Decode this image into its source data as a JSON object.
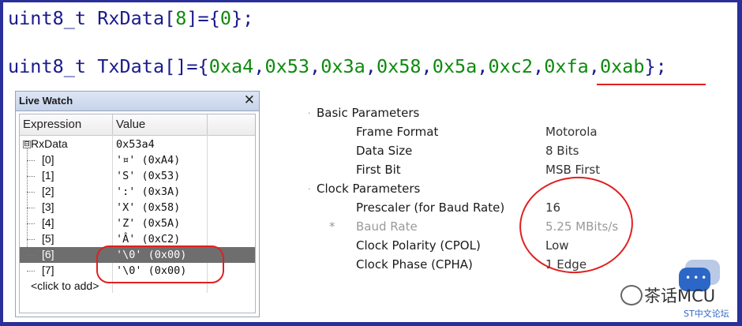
{
  "code": {
    "line1": {
      "type": "uint8_t",
      "name": "RxData",
      "open": "[",
      "size": "8",
      "close": "]={",
      "init": "0",
      "end": "};"
    },
    "line2": {
      "type": "uint8_t",
      "name": "TxData",
      "brackets": "[]={",
      "values": [
        "0xa4",
        "0x53",
        "0x3a",
        "0x58",
        "0x5a",
        "0xc2",
        "0xfa",
        "0xab"
      ],
      "end": "};"
    }
  },
  "watch": {
    "title": "Live Watch",
    "close_icon": "close-icon",
    "columns": {
      "expression": "Expression",
      "value": "Value"
    },
    "root": {
      "expander": "⊟",
      "name": "RxData",
      "value": "0x53a4"
    },
    "rows": [
      {
        "name": "[0]",
        "value": "'¤' (0xA4)"
      },
      {
        "name": "[1]",
        "value": "'S' (0x53)"
      },
      {
        "name": "[2]",
        "value": "':' (0x3A)"
      },
      {
        "name": "[3]",
        "value": "'X' (0x58)"
      },
      {
        "name": "[4]",
        "value": "'Z' (0x5A)"
      },
      {
        "name": "[5]",
        "value": "'Â' (0xC2)"
      },
      {
        "name": "[6]",
        "value": "'\\0' (0x00)"
      },
      {
        "name": "[7]",
        "value": "'\\0' (0x00)"
      }
    ],
    "add_hint": "<click to add>",
    "selected_index": 6
  },
  "config": {
    "basic": {
      "title": "Basic Parameters",
      "params": [
        {
          "label": "Frame Format",
          "value": "Motorola"
        },
        {
          "label": "Data Size",
          "value": "8 Bits"
        },
        {
          "label": "First Bit",
          "value": "MSB First"
        }
      ]
    },
    "clock": {
      "title": "Clock Parameters",
      "params": [
        {
          "label": "Prescaler (for Baud Rate)",
          "value": "16"
        },
        {
          "label": "Baud Rate",
          "value": "5.25 MBits/s",
          "marker": "*"
        },
        {
          "label": "Clock Polarity (CPOL)",
          "value": "Low"
        },
        {
          "label": "Clock Phase (CPHA)",
          "value": "1 Edge"
        }
      ]
    }
  },
  "watermark": {
    "brand": "茶话MCU",
    "site": "ST中文论坛"
  },
  "colors": {
    "annotation_red": "#e02020",
    "selection_gray": "#6e6e6e",
    "code_green": "#0e8a0e",
    "code_navy": "#1a1a8c",
    "frame_blue": "#2a2f9a"
  }
}
